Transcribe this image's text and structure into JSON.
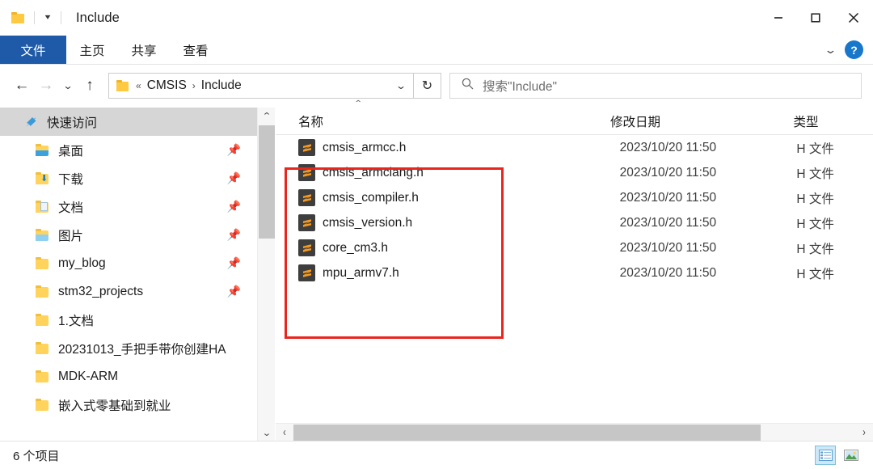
{
  "window": {
    "title": "Include",
    "quick_access_caret": "▾",
    "minimize_label": "—",
    "maximize_label": "□",
    "close_label": "✕"
  },
  "ribbon": {
    "tabs": [
      {
        "label": "文件",
        "active": true
      },
      {
        "label": "主页",
        "active": false
      },
      {
        "label": "共享",
        "active": false
      },
      {
        "label": "查看",
        "active": false
      }
    ],
    "expand_caret": "⌄",
    "help_label": "?"
  },
  "nav": {
    "back": "←",
    "forward": "→",
    "recent": "⌄",
    "up": "↑",
    "refresh": "↻",
    "breadcrumb": {
      "ellipsis": "«",
      "parts": [
        "CMSIS",
        "Include"
      ],
      "separator": "›",
      "caret": "⌄"
    }
  },
  "search": {
    "placeholder": "搜索\"Include\"",
    "icon": "search-icon"
  },
  "sidebar": {
    "header": {
      "label": "快速访问",
      "icon": "pin-star-icon"
    },
    "items": [
      {
        "label": "桌面",
        "icon": "desktop-folder-icon",
        "pinned": true
      },
      {
        "label": "下载",
        "icon": "downloads-folder-icon",
        "pinned": true
      },
      {
        "label": "文档",
        "icon": "documents-folder-icon",
        "pinned": true
      },
      {
        "label": "图片",
        "icon": "pictures-folder-icon",
        "pinned": true
      },
      {
        "label": "my_blog",
        "icon": "folder-icon",
        "pinned": true
      },
      {
        "label": "stm32_projects",
        "icon": "folder-icon",
        "pinned": true
      },
      {
        "label": "1.文档",
        "icon": "folder-icon",
        "pinned": false
      },
      {
        "label": "20231013_手把手带你创建HA",
        "icon": "folder-icon",
        "pinned": false
      },
      {
        "label": "MDK-ARM",
        "icon": "folder-icon",
        "pinned": false
      },
      {
        "label": "嵌入式零基础到就业",
        "icon": "folder-icon",
        "pinned": false
      }
    ],
    "scroll_up": "⌃",
    "scroll_down": "⌄"
  },
  "filelist": {
    "columns": {
      "name": "名称",
      "date": "修改日期",
      "type": "类型"
    },
    "sort_indicator": "⌃",
    "rows": [
      {
        "name": "cmsis_armcc.h",
        "date": "2023/10/20 11:50",
        "type": "H 文件"
      },
      {
        "name": "cmsis_armclang.h",
        "date": "2023/10/20 11:50",
        "type": "H 文件"
      },
      {
        "name": "cmsis_compiler.h",
        "date": "2023/10/20 11:50",
        "type": "H 文件"
      },
      {
        "name": "cmsis_version.h",
        "date": "2023/10/20 11:50",
        "type": "H 文件"
      },
      {
        "name": "core_cm3.h",
        "date": "2023/10/20 11:50",
        "type": "H 文件"
      },
      {
        "name": "mpu_armv7.h",
        "date": "2023/10/20 11:50",
        "type": "H 文件"
      }
    ],
    "scroll_left": "‹",
    "scroll_right": "›"
  },
  "annotation": {
    "color": "#e8251f",
    "shape": "rectangle"
  },
  "statusbar": {
    "item_count_text": "6 个项目",
    "view_details_label": "details-view",
    "view_thumbnails_label": "large-icons-view"
  }
}
